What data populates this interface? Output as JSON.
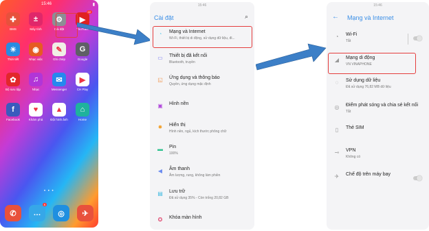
{
  "screen1": {
    "status_time": "15:46",
    "apps": [
      {
        "label": "BMS",
        "color": "#e8513c",
        "glyph": "✚"
      },
      {
        "label": "Máy tính",
        "color": "#e0276a",
        "glyph": "±"
      },
      {
        "label": "Cài đặt",
        "color": "#8d8d94",
        "glyph": "⚙"
      },
      {
        "label": "YouTube",
        "color": "#e02121",
        "glyph": "▶",
        "badge": "22"
      },
      {
        "label": "Thời tiết",
        "color": "#2a8be0",
        "glyph": "☀"
      },
      {
        "label": "Nhạc việc",
        "color": "#e65b22",
        "glyph": "◉"
      },
      {
        "label": "Ghi chép",
        "color": "#f1eee6",
        "glyph": "✎"
      },
      {
        "label": "Google",
        "color": "#5f5f66",
        "glyph": "G"
      },
      {
        "label": "Bộ sưu tập",
        "color": "#e2272b",
        "glyph": "✿"
      },
      {
        "label": "Nhạc",
        "color": "#b135d8",
        "glyph": "♫"
      },
      {
        "label": "Messenger",
        "color": "#2688ee",
        "glyph": "✉"
      },
      {
        "label": "CH Play",
        "color": "#ffffff",
        "glyph": "▶"
      },
      {
        "label": "Facebook",
        "color": "#3b5bbd",
        "glyph": "f"
      },
      {
        "label": "Khám phá",
        "color": "#ffffff",
        "glyph": "♥"
      },
      {
        "label": "Đội hình ảnh",
        "color": "#ffffff",
        "glyph": "▲"
      },
      {
        "label": "Home",
        "color": "#1fb29d",
        "glyph": "⌂"
      }
    ],
    "dock": [
      {
        "name": "phone",
        "color": "#e8513c",
        "glyph": "✆"
      },
      {
        "name": "messages",
        "color": "#36a7e8",
        "glyph": "…",
        "badge": "6"
      },
      {
        "name": "browser",
        "color": "#1f8fe0",
        "glyph": "◎"
      },
      {
        "name": "app",
        "color": "#e8513c",
        "glyph": "✈"
      }
    ]
  },
  "screen2": {
    "status_time": "15:46",
    "title": "Cài đặt",
    "items": [
      {
        "title": "Mạng và Internet",
        "sub": "Wi-Fi, thiết bị di động, sử dụng dữ liệu, đi...",
        "icon": "wifi-icon",
        "glyph": "◔",
        "color": "#7ad3ee"
      },
      {
        "title": "Thiết bị đã kết nối",
        "sub": "Bluetooth, truyền",
        "icon": "devices-icon",
        "glyph": "▭",
        "color": "#7c7cf0"
      },
      {
        "title": "Ứng dụng và thông báo",
        "sub": "Quyền, ứng dụng mặc định",
        "icon": "apps-icon",
        "glyph": "◱",
        "color": "#f08a3c"
      },
      {
        "title": "Hình nền",
        "sub": "",
        "icon": "wallpaper-icon",
        "glyph": "▣",
        "color": "#b24bdb"
      },
      {
        "title": "Hiển thị",
        "sub": "Hình nền, ngủ, kích thước phông chữ",
        "icon": "brightness-icon",
        "glyph": "✸",
        "color": "#f2a12e"
      },
      {
        "title": "Pin",
        "sub": "100%",
        "icon": "battery-icon",
        "glyph": "▬",
        "color": "#2ec28f"
      },
      {
        "title": "Âm thanh",
        "sub": "Âm lượng, rung, không làm phiền",
        "icon": "volume-icon",
        "glyph": "◀",
        "color": "#6c8cf0"
      },
      {
        "title": "Lưu trữ",
        "sub": "Đã sử dụng 35% - Còn trống 20,82 GB",
        "icon": "storage-icon",
        "glyph": "▤",
        "color": "#3db8e0"
      },
      {
        "title": "Khóa màn hình",
        "sub": "",
        "icon": "lock-icon",
        "glyph": "✪",
        "color": "#e0476f"
      }
    ]
  },
  "screen3": {
    "status_time": "15:46",
    "title": "Mạng và Internet",
    "items": [
      {
        "title": "Wi-Fi",
        "sub": "Tắt",
        "icon": "wifi-icon",
        "glyph": "◔",
        "toggle": true
      },
      {
        "title": "Mạng di động",
        "sub": "VN VINAPHONE",
        "icon": "signal-icon",
        "glyph": "◢",
        "toggle": false
      },
      {
        "title": "Sử dụng dữ liệu",
        "sub": "Đã sử dụng 76,82 MB dữ liệu",
        "icon": "data-usage-icon",
        "glyph": "◌",
        "toggle": false
      },
      {
        "title": "Điểm phát sóng và chia sẻ kết nối",
        "sub": "Tắt",
        "icon": "hotspot-icon",
        "glyph": "◎",
        "toggle": false
      },
      {
        "title": "Thẻ SIM",
        "sub": "",
        "icon": "sim-icon",
        "glyph": "▯",
        "toggle": false
      },
      {
        "title": "VPN",
        "sub": "Không có",
        "icon": "vpn-icon",
        "glyph": "⊸",
        "toggle": false
      },
      {
        "title": "Chế độ trên máy bay",
        "sub": "",
        "icon": "airplane-icon",
        "glyph": "✈",
        "toggle": true
      }
    ]
  }
}
